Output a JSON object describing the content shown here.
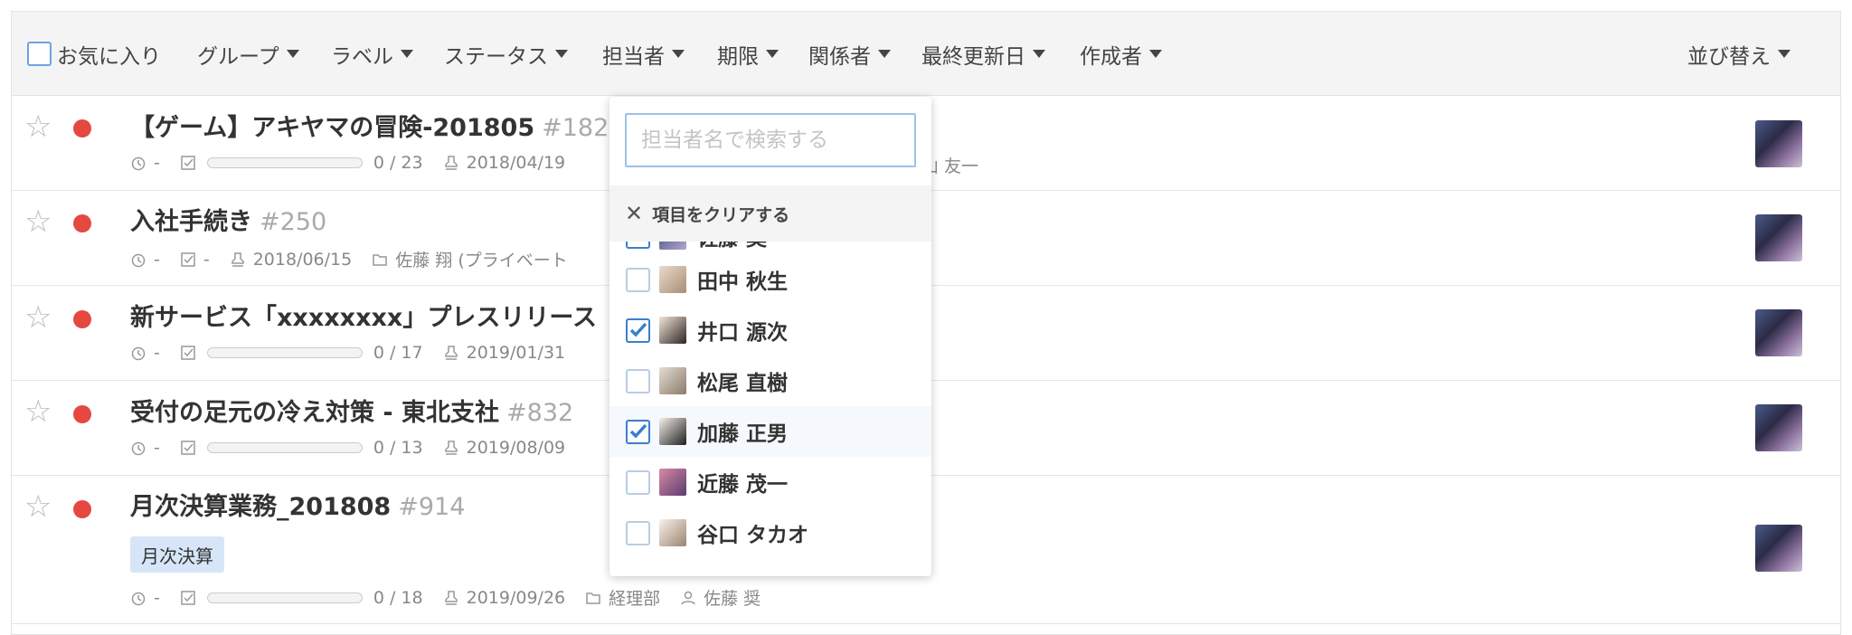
{
  "filters": {
    "favorites_label": "お気に入り",
    "group": "グループ",
    "label": "ラベル",
    "status": "ステータス",
    "assignee": "担当者",
    "due": "期限",
    "related": "関係者",
    "last_updated": "最終更新日",
    "creator": "作成者",
    "sort": "並び替え"
  },
  "tasks": [
    {
      "title": "【ゲーム】アキヤマの冒険-201805",
      "number": "#182",
      "timer": "-",
      "progress_text": "0 / 23",
      "progress": 0,
      "date": "2018/04/19",
      "person_tail": "山 友一"
    },
    {
      "title": "入社手続き",
      "number": "#250",
      "timer": "-",
      "check": "-",
      "date": "2018/06/15",
      "folder": "佐藤 翔 (プライベート"
    },
    {
      "title": "新サービス「xxxxxxxx」プレスリリース",
      "number": "",
      "timer": "-",
      "progress_text": "0 / 17",
      "progress": 0,
      "date": "2019/01/31"
    },
    {
      "title": "受付の足元の冷え対策 - 東北支社",
      "number": "#832",
      "timer": "-",
      "progress_text": "0 / 13",
      "progress": 0,
      "date": "2019/08/09"
    },
    {
      "title": "月次決算業務_201808",
      "number": "#914",
      "tag": "月次決算",
      "timer": "-",
      "progress_text": "0 / 18",
      "progress": 0,
      "date": "2019/09/26",
      "folder": "経理部",
      "person": "佐藤 奨"
    }
  ],
  "assignee_dropdown": {
    "search_placeholder": "担当者名で検索する",
    "clear_label": "項目をクリアする",
    "partial_name": "佐藤 奨",
    "members": [
      {
        "name": "田中 秋生",
        "checked": false
      },
      {
        "name": "井口 源次",
        "checked": true
      },
      {
        "name": "松尾 直樹",
        "checked": false
      },
      {
        "name": "加藤 正男",
        "checked": true
      },
      {
        "name": "近藤 茂一",
        "checked": false
      },
      {
        "name": "谷口 タカオ",
        "checked": false
      }
    ]
  },
  "colors": {
    "accent": "#3b7ed0",
    "status_red": "#e5483f",
    "tag_bg": "#d6e6f8"
  }
}
